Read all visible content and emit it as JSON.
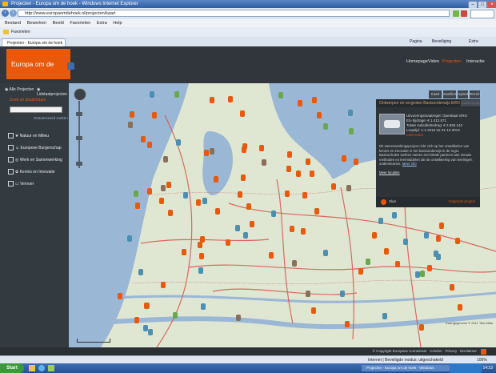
{
  "browser": {
    "title": "Projecten - Europa om de hoek - Windows Internet Explorer",
    "url": "http://www.europaomdehoek.nl/projecten/kaart",
    "menu": [
      "Bestand",
      "Bewerken",
      "Beeld",
      "Favorieten",
      "Extra",
      "Help"
    ],
    "favorites_label": "Favorieten",
    "tab_label": "Projecten - Europa om de hoek",
    "tools": [
      "Pagina",
      "Beveiliging",
      "Extra"
    ],
    "status_text": "Internet | Beveiligde modus: uitgeschakeld",
    "zoom": "100%"
  },
  "site": {
    "logo": "Europa om de hoek",
    "nav": [
      "Homepage",
      "Video",
      "Projecten",
      "Interactie"
    ],
    "accent": "#e8590c"
  },
  "sidebar": {
    "radio_1": "Alle Projecten",
    "radio_2": "Lidstaatprojecten",
    "search_label": "Zoek op plaatsnaam",
    "search_link": "Geavanceerd zoeken",
    "items": [
      {
        "icon": "leaf-icon",
        "label": "Natuur en Milieu"
      },
      {
        "icon": "people-icon",
        "label": "Europese Burgerschap"
      },
      {
        "icon": "globe-icon",
        "label": "Werk en Samenwerking"
      },
      {
        "icon": "gear-icon",
        "label": "Kennis en Innovatie"
      },
      {
        "icon": "flag-icon",
        "label": "Vervoer"
      }
    ]
  },
  "map": {
    "attribution": "Kaartgegevens © 2011 Tele Atlas",
    "panel": {
      "title": "Ontwerpen en vergroten Basisonderwijs ERO",
      "tabs": [
        "Kaart",
        "Satelliet",
        "Hybride",
        "Terrein"
      ],
      "search_placeholder": "Zoeken op plaatsnaam",
      "meta": [
        "Uitvoeringsmaatregel: Openbaar ERO",
        "EU-bijdrage: € 1.412.571",
        "Totale subsidiebedrag: € 2.825.142",
        "Looptijd: 1-1-2010 tot 31-12-2013"
      ],
      "meta_link": "Lees meer",
      "body": "Dit samenwerkingsproject richt zich op het ontwikkelen van kennis en innovatie in het basisonderwijs in de regio. Basisscholen werken samen met lokale partners aan nieuwe methoden en leermiddelen die de ontwikkeling van leerlingen ondersteunen.",
      "more_link": "Meer info",
      "nav_link": "Meer locaties",
      "close_label": "Sluit",
      "next_label": "Volgende project"
    }
  },
  "footer": {
    "copyright": "© Copyright Europese Commissie",
    "links": [
      "Colofon",
      "Privacy",
      "Disclaimer"
    ]
  },
  "taskbar": {
    "start": "Start",
    "item": "Projecten - Europa om de hoek - Windows",
    "clock": "14:23"
  }
}
